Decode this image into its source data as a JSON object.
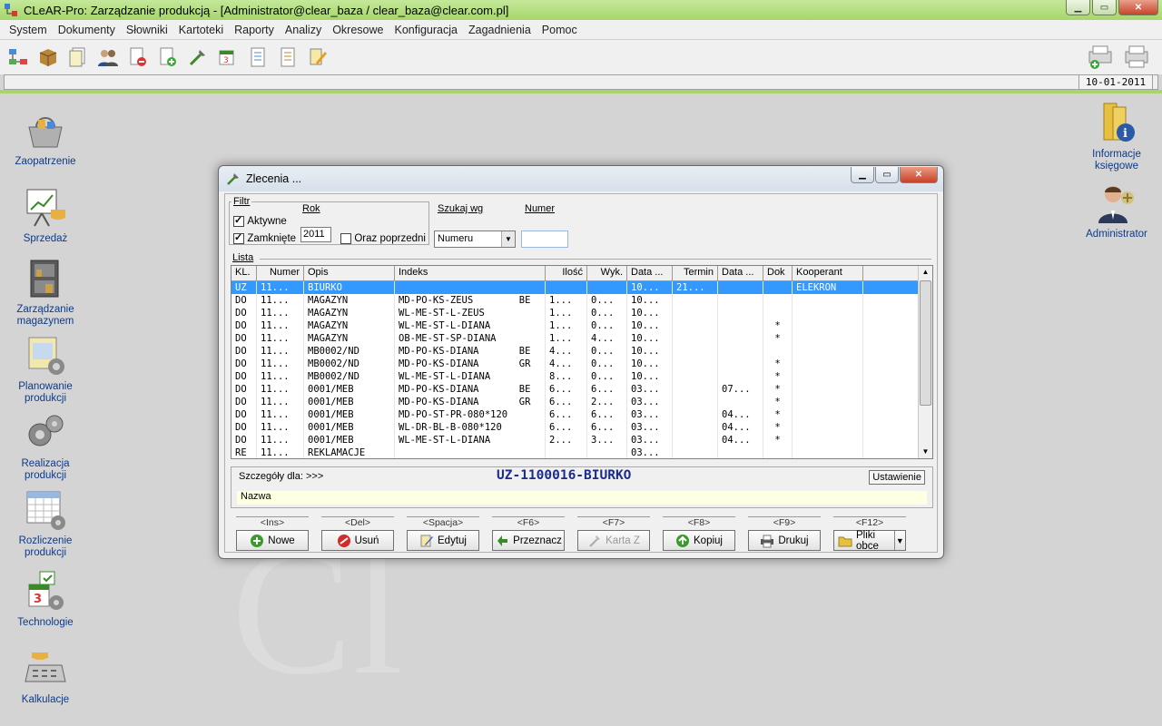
{
  "app": {
    "title": "CLeAR-Pro:  Zarządzanie produkcją - [Administrator@clear_baza / clear_baza@clear.com.pl]",
    "date": "10-01-2011",
    "watermark": "Cl"
  },
  "menu": [
    "System",
    "Dokumenty",
    "Słowniki",
    "Kartoteki",
    "Raporty",
    "Analizy",
    "Okresowe",
    "Konfiguracja",
    "Zagadnienia",
    "Pomoc"
  ],
  "toolbar_icons": [
    "hierarchy-icon",
    "package-icon",
    "documents-icon",
    "users-icon",
    "document-remove-icon",
    "document-add-icon",
    "tools-icon",
    "calendar-icon",
    "report-icon",
    "list-icon",
    "edit-icon"
  ],
  "desktop": {
    "left": [
      {
        "label": "Zaopatrzenie",
        "icon": "basket-icon"
      },
      {
        "label": "Sprzedaż",
        "icon": "sales-chart-icon"
      },
      {
        "label": "Zarządzanie magazynem",
        "icon": "warehouse-icon"
      },
      {
        "label": "Planowanie produkcji",
        "icon": "planning-icon"
      },
      {
        "label": "Realizacja produkcji",
        "icon": "gears-icon"
      },
      {
        "label": "Rozliczenie produkcji",
        "icon": "calendar-gear-icon"
      },
      {
        "label": "Technologie",
        "icon": "technology-icon"
      },
      {
        "label": "Kalkulacje",
        "icon": "calculator-icon"
      }
    ],
    "right": [
      {
        "label": "Informacje księgowe",
        "icon": "info-folder-icon"
      },
      {
        "label": "Administrator",
        "icon": "admin-user-icon"
      }
    ]
  },
  "dialog": {
    "title": "Zlecenia ...",
    "filter": {
      "legend": "Filtr",
      "active_label": "Aktywne",
      "closed_label": "Zamknięte",
      "year_legend": "Rok",
      "year_value": "2011",
      "previous_label": "Oraz poprzedni"
    },
    "search": {
      "legend": "Szukaj wg",
      "value": "Numeru"
    },
    "number": {
      "legend": "Numer",
      "value": ""
    },
    "list_legend": "Lista",
    "columns": [
      "KL.",
      "Numer",
      "Opis",
      "Indeks",
      "Ilość",
      "Wyk.",
      "Data ...",
      "Termin",
      "Data ...",
      "Dok",
      "Kooperant"
    ],
    "rows": [
      [
        "UZ",
        "11...",
        "BIURKO",
        "",
        "",
        "",
        "10...",
        "21...",
        "",
        "",
        "ELEKRON"
      ],
      [
        "DO",
        "11...",
        "MAGAZYN",
        "MD-PO-KS-ZEUS        BE",
        "1...",
        "0...",
        "10...",
        "",
        "",
        "",
        ""
      ],
      [
        "DO",
        "11...",
        "MAGAZYN",
        "WL-ME-ST-L-ZEUS",
        "1...",
        "0...",
        "10...",
        "",
        "",
        "",
        ""
      ],
      [
        "DO",
        "11...",
        "MAGAZYN",
        "WL-ME-ST-L-DIANA",
        "1...",
        "0...",
        "10...",
        "",
        "",
        "*",
        ""
      ],
      [
        "DO",
        "11...",
        "MAGAZYN",
        "OB-ME-ST-SP-DIANA",
        "1...",
        "4...",
        "10...",
        "",
        "",
        "*",
        ""
      ],
      [
        "DO",
        "11...",
        "MB0002/ND",
        "MD-PO-KS-DIANA       BE",
        "4...",
        "0...",
        "10...",
        "",
        "",
        "",
        ""
      ],
      [
        "DO",
        "11...",
        "MB0002/ND",
        "MD-PO-KS-DIANA       GR",
        "4...",
        "0...",
        "10...",
        "",
        "",
        "*",
        ""
      ],
      [
        "DO",
        "11...",
        "MB0002/ND",
        "WL-ME-ST-L-DIANA",
        "8...",
        "0...",
        "10...",
        "",
        "",
        "*",
        ""
      ],
      [
        "DO",
        "11...",
        "0001/MEB",
        "MD-PO-KS-DIANA       BE",
        "6...",
        "6...",
        "03...",
        "",
        "07...",
        "*",
        ""
      ],
      [
        "DO",
        "11...",
        "0001/MEB",
        "MD-PO-KS-DIANA       GR",
        "6...",
        "2...",
        "03...",
        "",
        "",
        "*",
        ""
      ],
      [
        "DO",
        "11...",
        "0001/MEB",
        "MD-PO-ST-PR-080*120",
        "6...",
        "6...",
        "03...",
        "",
        "04...",
        "*",
        ""
      ],
      [
        "DO",
        "11...",
        "0001/MEB",
        "WL-DR-BL-B-080*120",
        "6...",
        "6...",
        "03...",
        "",
        "04...",
        "*",
        ""
      ],
      [
        "DO",
        "11...",
        "0001/MEB",
        "WL-ME-ST-L-DIANA",
        "2...",
        "3...",
        "03...",
        "",
        "04...",
        "*",
        ""
      ],
      [
        "RE",
        "11...",
        "REKLAMACJE",
        "",
        "",
        "",
        "03...",
        "",
        "",
        "",
        ""
      ]
    ],
    "details": {
      "title": "Szczegóły dla: >>>",
      "id": "UZ-1100016-BIURKO",
      "settings_label": "Ustawienie",
      "name_label": "Nazwa"
    },
    "buttons": [
      {
        "key": "<Ins>",
        "label": "Nowe",
        "icon": "add-icon",
        "enabled": true
      },
      {
        "key": "<Del>",
        "label": "Usuń",
        "icon": "delete-icon",
        "enabled": true
      },
      {
        "key": "<Spacja>",
        "label": "Edytuj",
        "icon": "edit-icon",
        "enabled": true
      },
      {
        "key": "<F6>",
        "label": "Przeznacz",
        "icon": "assign-icon",
        "enabled": true
      },
      {
        "key": "<F7>",
        "label": "Karta Z",
        "icon": "card-icon",
        "enabled": false
      },
      {
        "key": "<F8>",
        "label": "Kopiuj",
        "icon": "copy-icon",
        "enabled": true
      },
      {
        "key": "<F9>",
        "label": "Drukuj",
        "icon": "print-icon",
        "enabled": true
      },
      {
        "key": "<F12>",
        "label": "Pliki obce",
        "icon": "folder-icon",
        "enabled": true
      }
    ]
  }
}
